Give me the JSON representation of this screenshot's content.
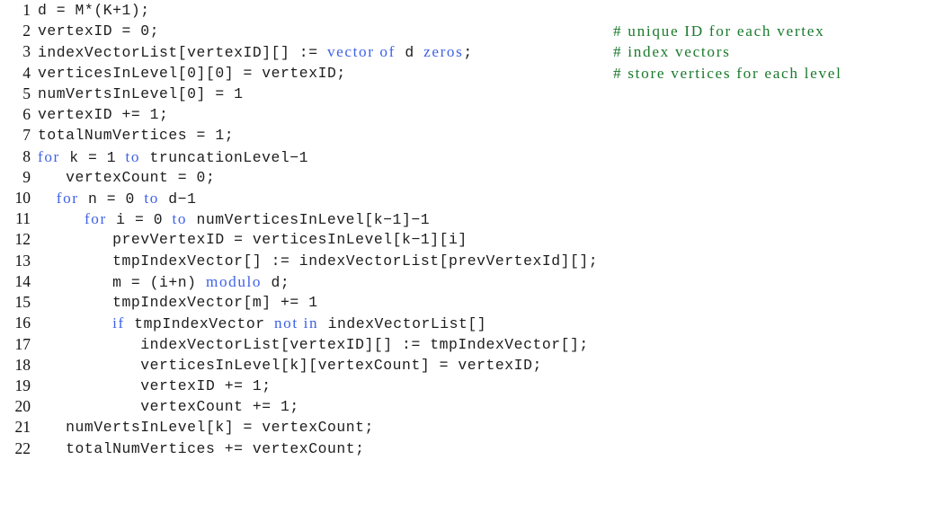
{
  "listing": {
    "language": "pseudocode",
    "colors": {
      "text": "#1d1d1d",
      "keyword": "#3f62e8",
      "comment": "#1a7a2c",
      "line_number": "#111111",
      "background": "#ffffff"
    },
    "lines": [
      {
        "number": "1",
        "code": "d = M*(K+1);",
        "comment": ""
      },
      {
        "number": "2",
        "code": "vertexID = 0;",
        "comment": "# unique ID for each vertex"
      },
      {
        "number": "3",
        "code": "indexVectorList[vertexID][] := ",
        "code_keyword": "vector of",
        "code_tail": " d ",
        "code_keyword2": "zeros",
        "code_tail2": ";",
        "comment": "# index vectors"
      },
      {
        "number": "4",
        "code": "verticesInLevel[0][0] = vertexID;",
        "comment": "# store vertices for each level"
      },
      {
        "number": "5",
        "code": "numVertsInLevel[0] = 1",
        "comment": ""
      },
      {
        "number": "6",
        "code": "vertexID += 1;",
        "comment": ""
      },
      {
        "number": "7",
        "code": "totalNumVertices = 1;",
        "comment": ""
      },
      {
        "number": "8",
        "indent": "",
        "keyword": "for",
        "code": " k = 1 ",
        "keyword2": "to",
        "code_tail": " truncationLevel−1",
        "comment": ""
      },
      {
        "number": "9",
        "code": "   vertexCount = 0;",
        "comment": ""
      },
      {
        "number": "10",
        "indent": "  ",
        "keyword": "for",
        "code": " n = 0 ",
        "keyword2": "to",
        "code_tail": " d−1",
        "comment": ""
      },
      {
        "number": "11",
        "indent": "     ",
        "keyword": "for",
        "code": " i = 0 ",
        "keyword2": "to",
        "code_tail": " numVerticesInLevel[k−1]−1",
        "comment": ""
      },
      {
        "number": "12",
        "code": "        prevVertexID = verticesInLevel[k−1][i]",
        "comment": ""
      },
      {
        "number": "13",
        "code": "        tmpIndexVector[] := indexVectorList[prevVertexId][];",
        "comment": ""
      },
      {
        "number": "14",
        "indent": "        ",
        "code": "m = (i+n) ",
        "keyword": "modulo",
        "code_tail": " d;",
        "comment": ""
      },
      {
        "number": "15",
        "code": "        tmpIndexVector[m] += 1",
        "comment": ""
      },
      {
        "number": "16",
        "indent": "        ",
        "keyword": "if",
        "code": " tmpIndexVector ",
        "keyword2": "not in",
        "code_tail": " indexVectorList[]",
        "comment": ""
      },
      {
        "number": "17",
        "code": "           indexVectorList[vertexID][] := tmpIndexVector[];",
        "comment": ""
      },
      {
        "number": "18",
        "code": "           verticesInLevel[k][vertexCount] = vertexID;",
        "comment": ""
      },
      {
        "number": "19",
        "code": "           vertexID += 1;",
        "comment": ""
      },
      {
        "number": "20",
        "code": "           vertexCount += 1;",
        "comment": ""
      },
      {
        "number": "21",
        "code": "   numVertsInLevel[k] = vertexCount;",
        "comment": ""
      },
      {
        "number": "22",
        "code": "   totalNumVertices += vertexCount;",
        "comment": ""
      }
    ]
  }
}
